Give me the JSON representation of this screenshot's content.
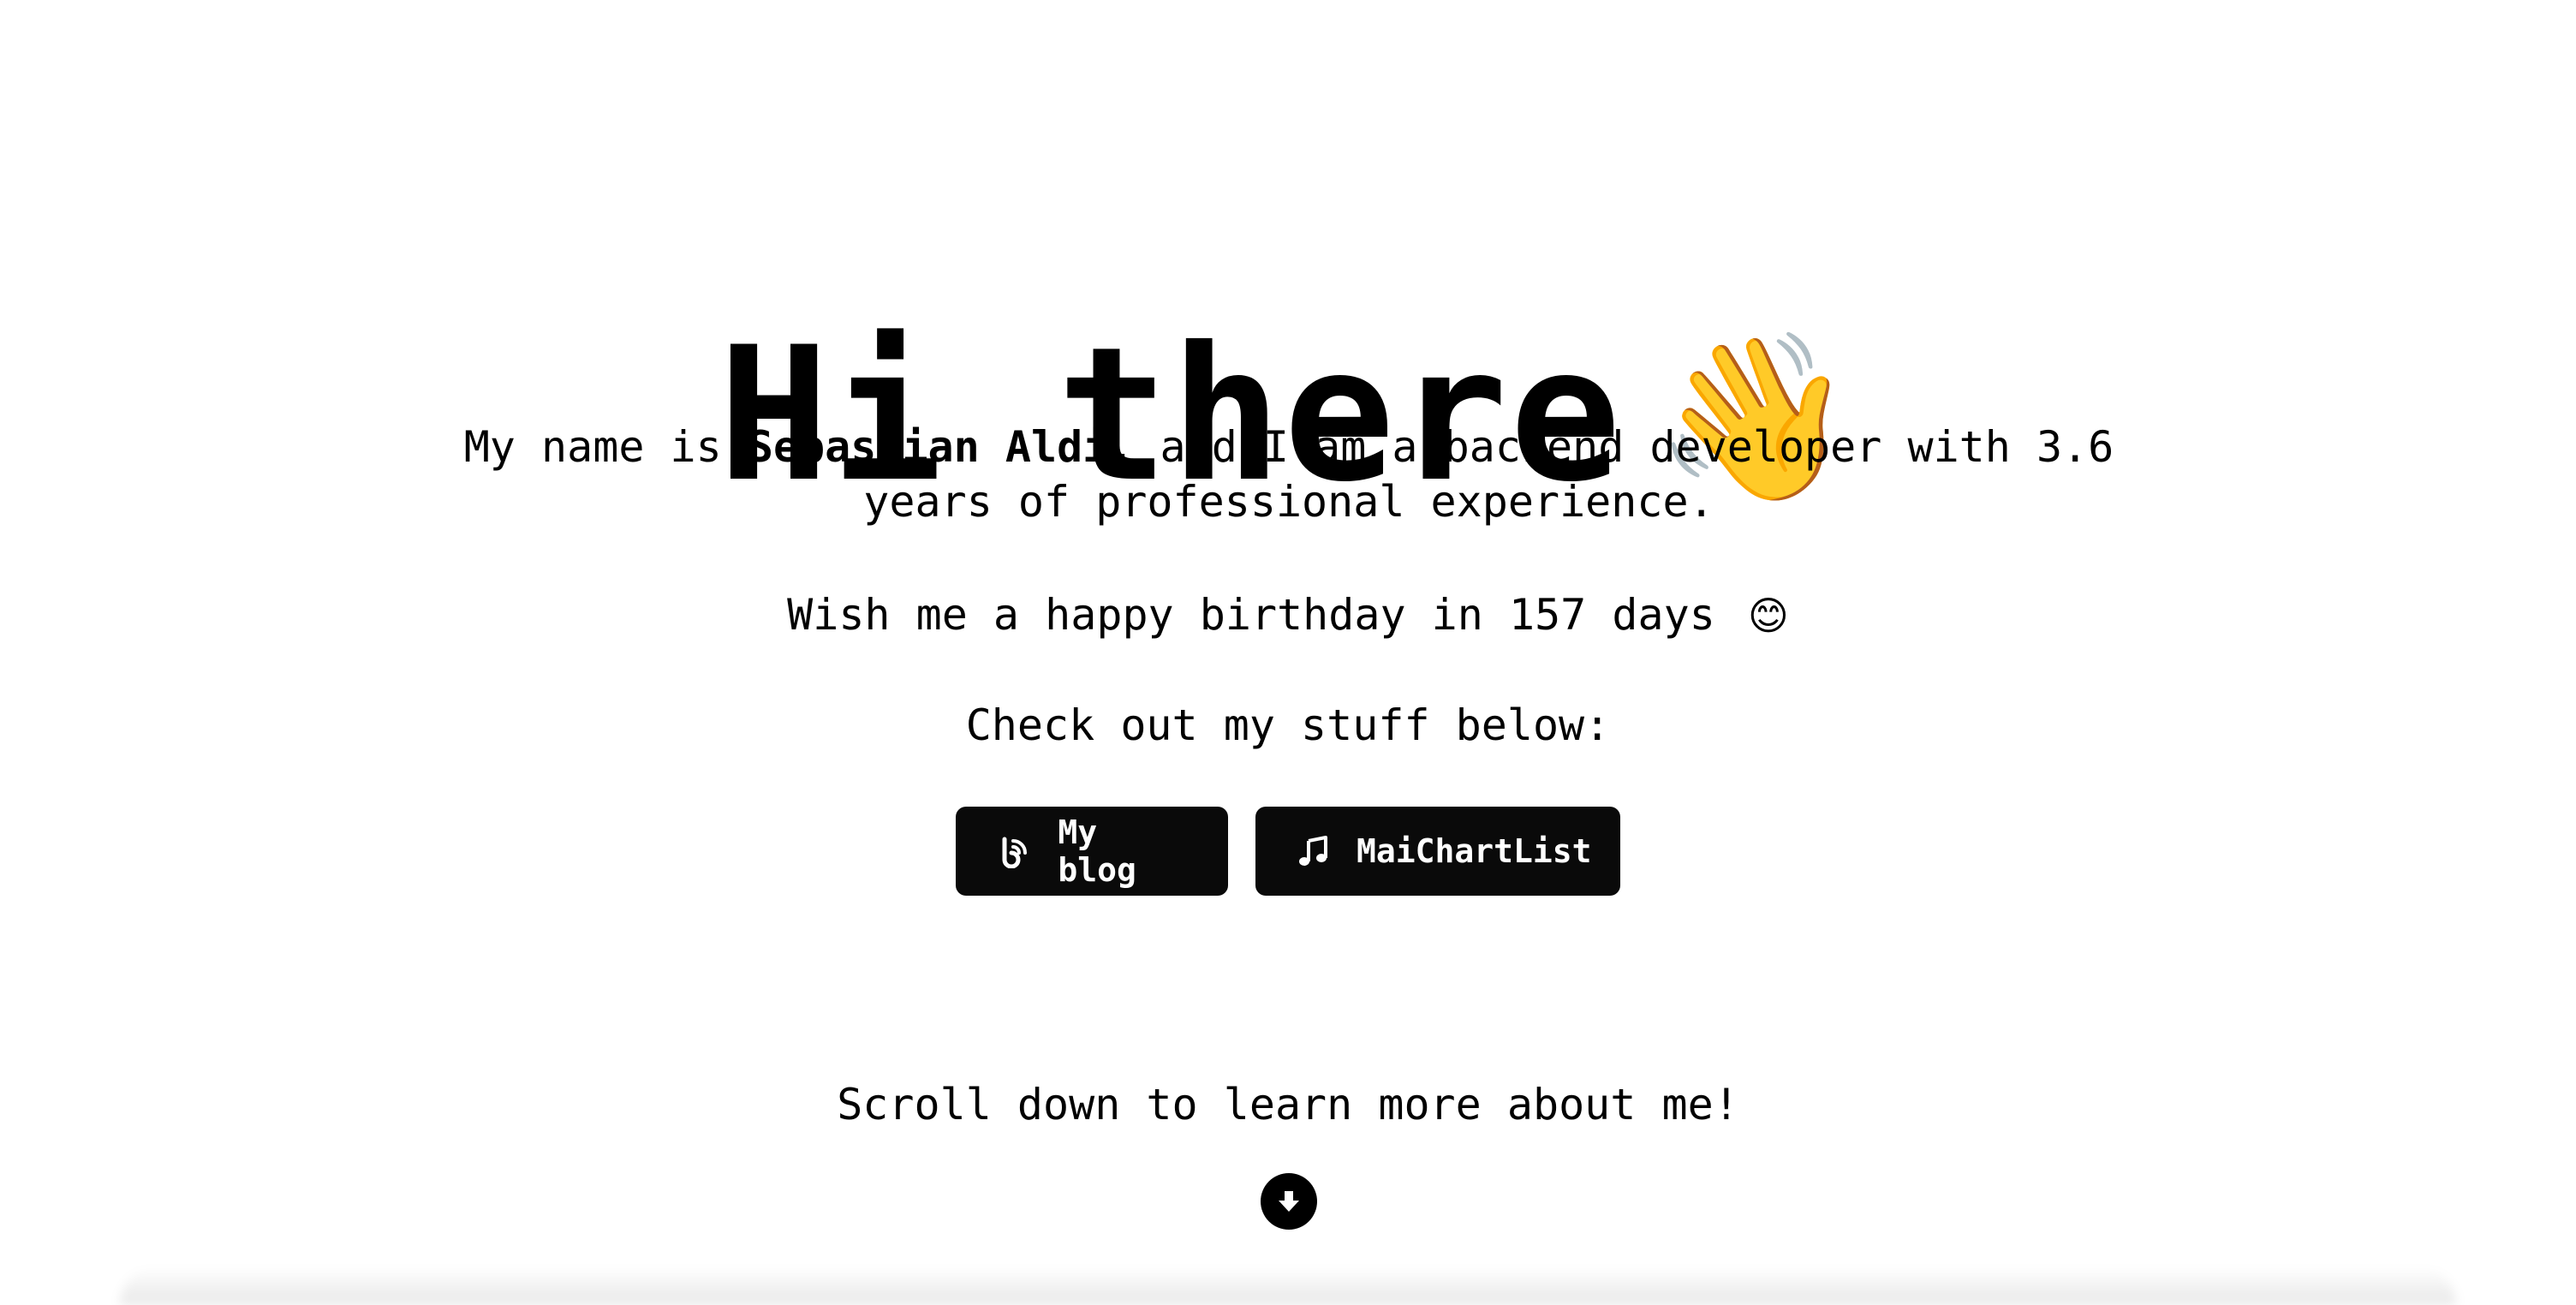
{
  "hero": {
    "title": "Hi there",
    "title_emoji": "👋",
    "intro_prefix": "My name is ",
    "intro_name": "Sebastian Aldi,",
    "intro_suffix": " and I am a backend developer with 3.6 years of professional experience.",
    "birthday_text": "Wish me a happy birthday in 157 days",
    "birthday_emoji": "😊",
    "checkout_text": "Check out my stuff below:"
  },
  "buttons": [
    {
      "label": "My blog",
      "icon": "blog-rss-icon"
    },
    {
      "label": "MaiChartList",
      "icon": "music-note-icon"
    }
  ],
  "scroll": {
    "text": "Scroll down to learn more about me!",
    "icon": "arrow-down-circle-icon"
  },
  "colors": {
    "background": "#ffffff",
    "text": "#000000",
    "button_bg": "#0a0a0a",
    "button_text": "#ffffff"
  }
}
